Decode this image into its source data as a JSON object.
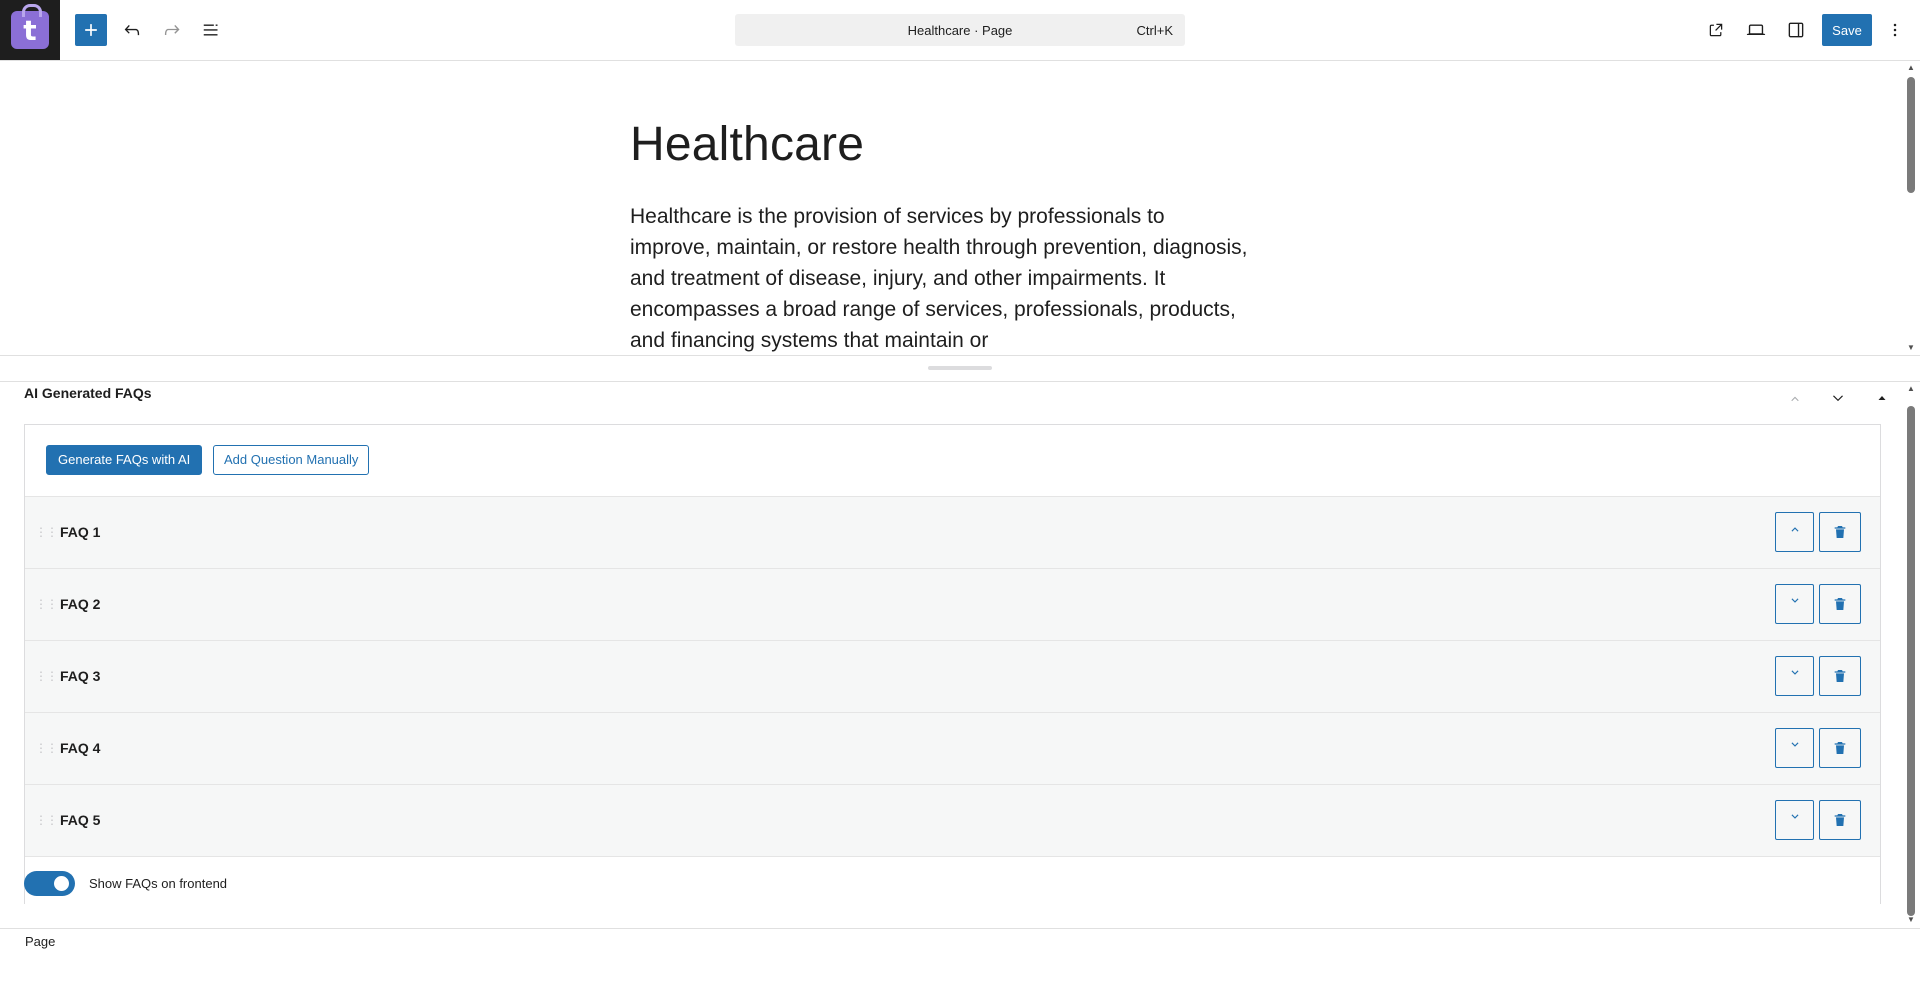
{
  "toolbar": {
    "logo_letter": "t",
    "command_title": "Healthcare · Page",
    "command_shortcut": "Ctrl+K",
    "save_label": "Save"
  },
  "editor": {
    "title": "Healthcare",
    "body": "Healthcare is the provision of services by professionals to improve, maintain, or restore health through prevention, diagnosis, and treatment of disease, injury, and other impairments. It encompasses a broad range of services, professionals, products, and financing systems that maintain or"
  },
  "metabox": {
    "header": "AI Generated FAQs",
    "generate_label": "Generate FAQs with AI",
    "add_label": "Add Question Manually",
    "faqs": [
      {
        "label": "FAQ 1",
        "expanded": true
      },
      {
        "label": "FAQ 2",
        "expanded": false
      },
      {
        "label": "FAQ 3",
        "expanded": false
      },
      {
        "label": "FAQ 4",
        "expanded": false
      },
      {
        "label": "FAQ 5",
        "expanded": false
      }
    ],
    "toggle_label": "Show FAQs on frontend",
    "toggle_on": true
  },
  "statusbar": {
    "breadcrumb": "Page"
  },
  "colors": {
    "accent": "#2271b1",
    "logo": "#8b6fd6"
  }
}
